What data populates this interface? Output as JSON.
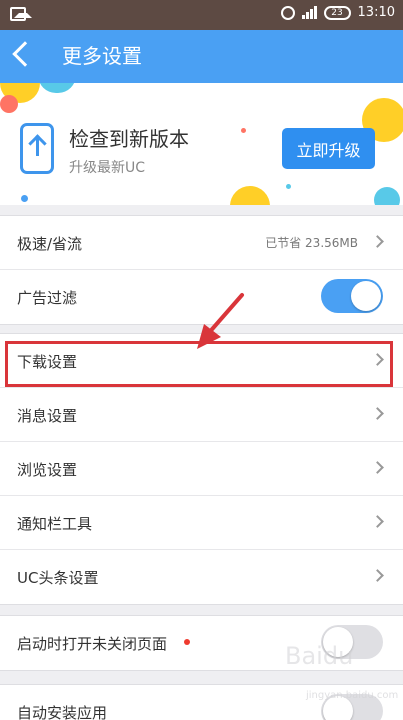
{
  "status_bar": {
    "time": "13:10",
    "battery": "23"
  },
  "header": {
    "title": "更多设置"
  },
  "banner": {
    "title": "检查到新版本",
    "subtitle": "升级最新UC",
    "button": "立即升级"
  },
  "settings": {
    "speed_saving": {
      "label": "极速/省流",
      "value": "已节省 23.56MB"
    },
    "ad_filter": {
      "label": "广告过滤",
      "enabled": true
    },
    "download": {
      "label": "下载设置"
    },
    "message": {
      "label": "消息设置"
    },
    "browse": {
      "label": "浏览设置"
    },
    "notification_tools": {
      "label": "通知栏工具"
    },
    "uc_headlines": {
      "label": "UC头条设置"
    },
    "restore_pages": {
      "label": "启动时打开未关闭页面",
      "enabled": false
    },
    "auto_install": {
      "label": "自动安装应用",
      "enabled": false
    }
  },
  "watermark": {
    "text": "Baidu",
    "subtext": "jingyan.baidu.com"
  },
  "colors": {
    "accent": "#4aa0f3",
    "highlight": "#d9353a"
  }
}
